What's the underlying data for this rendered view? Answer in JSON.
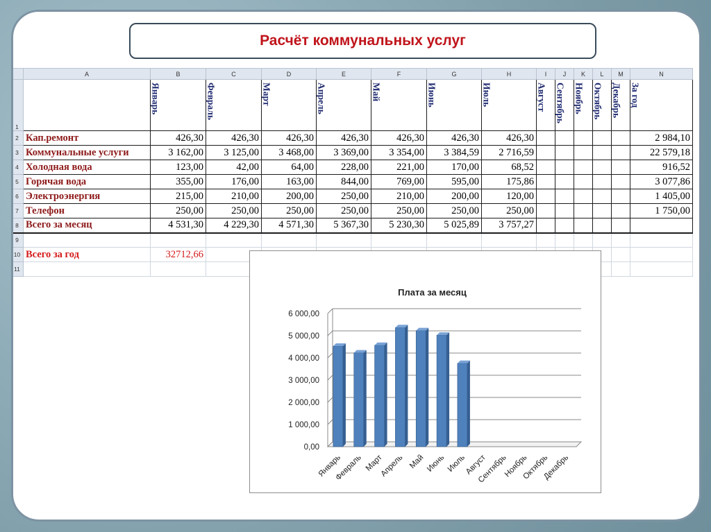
{
  "page": {
    "title": "Расчёт коммунальных услуг"
  },
  "sheet": {
    "col_headers": [
      "A",
      "B",
      "C",
      "D",
      "E",
      "F",
      "G",
      "H",
      "I",
      "J",
      "K",
      "L",
      "M",
      "N"
    ],
    "row_numbers": [
      "1",
      "2",
      "3",
      "4",
      "5",
      "6",
      "7",
      "8",
      "9",
      "10",
      "11"
    ],
    "month_headers": [
      "Январь",
      "Февраль",
      "Март",
      "Апрель",
      "Май",
      "Июнь",
      "Июль",
      "Август",
      "Сентябрь",
      "Ноябрь",
      "Октябрь",
      "Декабрь"
    ],
    "year_header": "За год",
    "rows": [
      {
        "label": "Кап.ремонт",
        "values": [
          "426,30",
          "426,30",
          "426,30",
          "426,30",
          "426,30",
          "426,30",
          "426,30"
        ],
        "year": "2 984,10"
      },
      {
        "label": "Коммунальные услуги",
        "values": [
          "3 162,00",
          "3 125,00",
          "3 468,00",
          "3 369,00",
          "3 354,00",
          "3 384,59",
          "2 716,59"
        ],
        "year": "22 579,18"
      },
      {
        "label": "Холодная вода",
        "values": [
          "123,00",
          "42,00",
          "64,00",
          "228,00",
          "221,00",
          "170,00",
          "68,52"
        ],
        "year": "916,52"
      },
      {
        "label": "Горячая вода",
        "values": [
          "355,00",
          "176,00",
          "163,00",
          "844,00",
          "769,00",
          "595,00",
          "175,86"
        ],
        "year": "3 077,86"
      },
      {
        "label": "Электроэнергия",
        "values": [
          "215,00",
          "210,00",
          "200,00",
          "250,00",
          "210,00",
          "200,00",
          "120,00"
        ],
        "year": "1 405,00"
      },
      {
        "label": "Телефон",
        "values": [
          "250,00",
          "250,00",
          "250,00",
          "250,00",
          "250,00",
          "250,00",
          "250,00"
        ],
        "year": "1 750,00"
      },
      {
        "label": "Всего за месяц",
        "values": [
          "4 531,30",
          "4 229,30",
          "4 571,30",
          "5 367,30",
          "5 230,30",
          "5 025,89",
          "3 757,27"
        ],
        "year": ""
      }
    ],
    "year_total": {
      "label": "Всего за год",
      "value": "32712,66"
    }
  },
  "chart_data": {
    "type": "bar",
    "title": "Плата за месяц",
    "categories": [
      "Январь",
      "Февраль",
      "Март",
      "Апрель",
      "Май",
      "Июнь",
      "Июль",
      "Август",
      "Сентябрь",
      "Ноябрь",
      "Октябрь",
      "Декабрь"
    ],
    "values": [
      4531.3,
      4229.3,
      4571.3,
      5367.3,
      5230.3,
      5025.89,
      3757.27,
      null,
      null,
      null,
      null,
      null
    ],
    "ylim": [
      0,
      6000
    ],
    "yticks": [
      "0,00",
      "1 000,00",
      "2 000,00",
      "3 000,00",
      "4 000,00",
      "5 000,00",
      "6 000,00"
    ],
    "grid": true,
    "bar_color": "#4f81bd"
  }
}
